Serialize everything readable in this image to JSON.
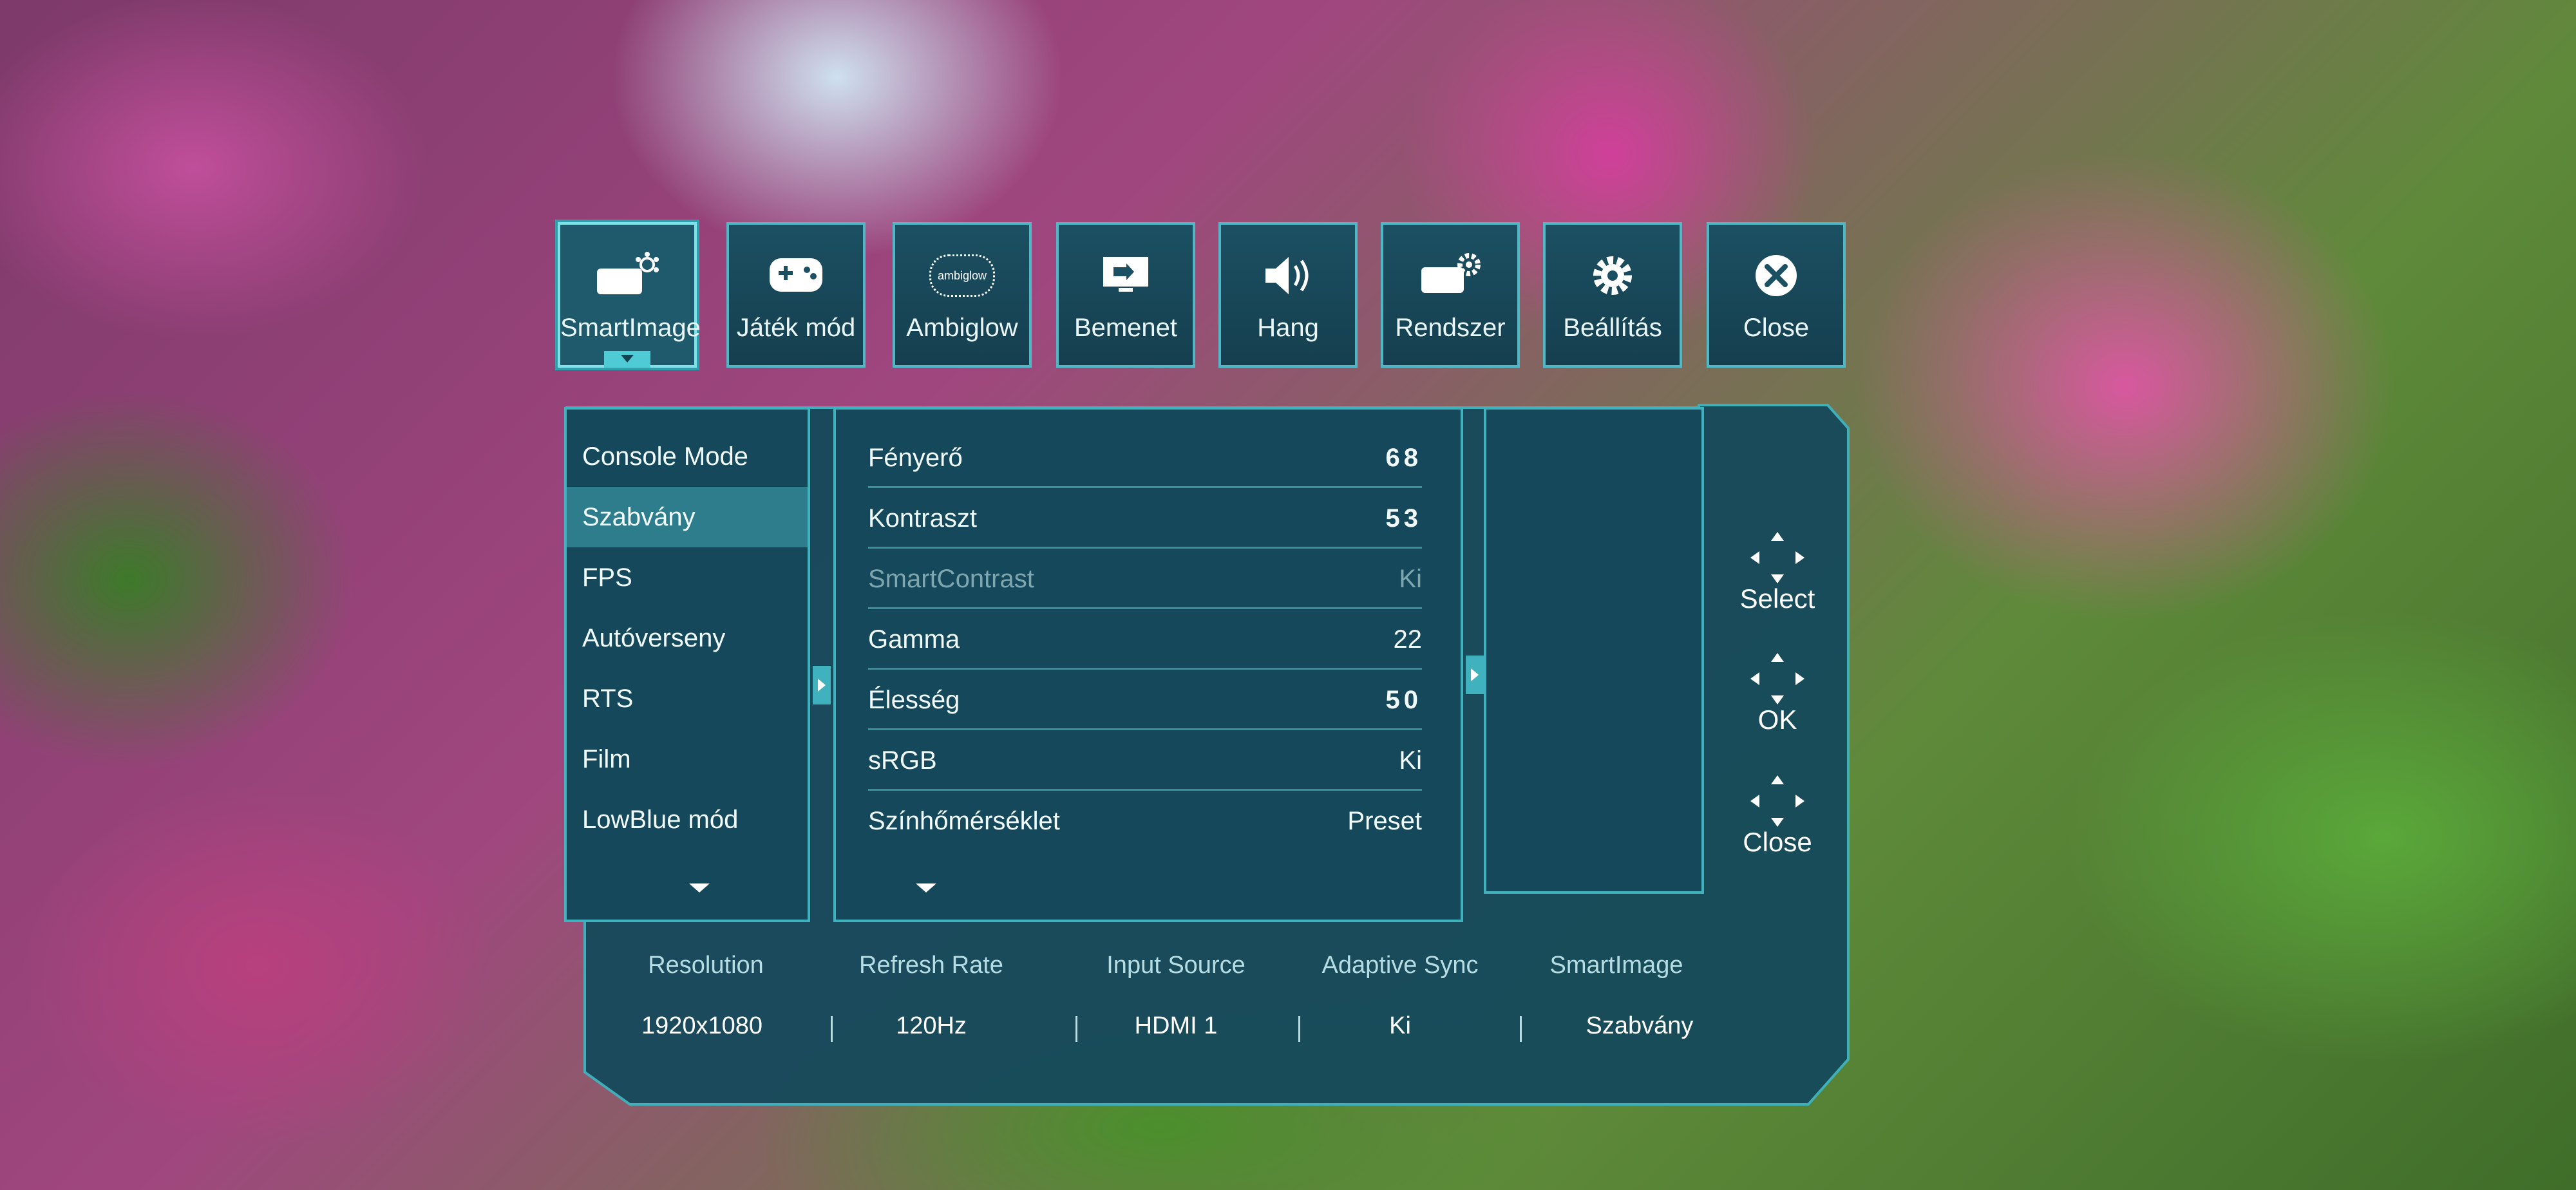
{
  "tabs": [
    {
      "label": "SmartImage",
      "icon": "smartimage-icon",
      "active": true
    },
    {
      "label": "Játék mód",
      "icon": "gamepad-icon",
      "active": false
    },
    {
      "label": "Ambiglow",
      "icon": "ambiglow-logo-icon",
      "icon_text": "ambiglow",
      "active": false
    },
    {
      "label": "Bemenet",
      "icon": "input-monitor-icon",
      "active": false
    },
    {
      "label": "Hang",
      "icon": "speaker-icon",
      "active": false
    },
    {
      "label": "Rendszer",
      "icon": "system-gear-icon",
      "active": false
    },
    {
      "label": "Beállítás",
      "icon": "settings-gear-icon",
      "active": false
    },
    {
      "label": "Close",
      "icon": "close-icon",
      "active": false
    }
  ],
  "smartimage_modes": {
    "items": [
      "Console Mode",
      "Szabvány",
      "FPS",
      "Autóverseny",
      "RTS",
      "Film",
      "LowBlue mód"
    ],
    "selected": "Szabvány"
  },
  "settings": [
    {
      "name": "Fényerő",
      "value": "68",
      "style": "numeric"
    },
    {
      "name": "Kontraszt",
      "value": "53",
      "style": "numeric"
    },
    {
      "name": "SmartContrast",
      "value": "Ki",
      "disabled": true
    },
    {
      "name": "Gamma",
      "value": "22"
    },
    {
      "name": "Élesség",
      "value": "50",
      "style": "numeric"
    },
    {
      "name": "sRGB",
      "value": "Ki"
    },
    {
      "name": "Színhőmérséklet",
      "value": "Preset"
    }
  ],
  "navigation": [
    {
      "label": "Select",
      "icon": "dpad-select-icon"
    },
    {
      "label": "OK",
      "icon": "dpad-ok-icon"
    },
    {
      "label": "Close",
      "icon": "dpad-close-icon"
    }
  ],
  "info_bar": {
    "headers": [
      "Resolution",
      "Refresh Rate",
      "Input Source",
      "Adaptive Sync",
      "SmartImage"
    ],
    "values": [
      "1920x1080",
      "120Hz",
      "HDMI 1",
      "Ki",
      "Szabvány"
    ]
  },
  "colors": {
    "osd_background": "#15485a",
    "osd_border": "#3fb2bd",
    "selection": "#2d7d8d",
    "text": "#f2fbfc"
  }
}
